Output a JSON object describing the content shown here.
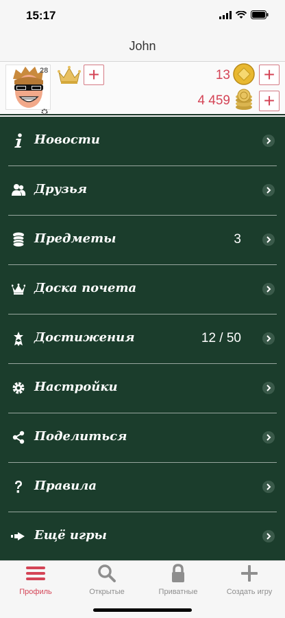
{
  "status_bar": {
    "time": "15:17"
  },
  "nav": {
    "title": "John"
  },
  "profile": {
    "level": "28",
    "coins_top": "13",
    "coins_bottom": "4 459"
  },
  "menu": {
    "items": [
      {
        "label": "Новости",
        "count": "",
        "icon": "info-icon"
      },
      {
        "label": "Друзья",
        "count": "",
        "icon": "friends-icon"
      },
      {
        "label": "Предметы",
        "count": "3",
        "icon": "coins-icon"
      },
      {
        "label": "Доска почета",
        "count": "",
        "icon": "crown-icon"
      },
      {
        "label": "Достижения",
        "count": "12 / 50",
        "icon": "medal-icon"
      },
      {
        "label": "Настройки",
        "count": "",
        "icon": "gear-icon"
      },
      {
        "label": "Поделиться",
        "count": "",
        "icon": "share-icon"
      },
      {
        "label": "Правила",
        "count": "",
        "icon": "question-icon"
      },
      {
        "label": "Ещё игры",
        "count": "",
        "icon": "more-games-icon"
      }
    ]
  },
  "tabs": [
    {
      "label": "Профиль",
      "icon": "menu-icon",
      "active": true
    },
    {
      "label": "Открытые",
      "icon": "search-icon",
      "active": false
    },
    {
      "label": "Приватные",
      "icon": "lock-icon",
      "active": false
    },
    {
      "label": "Создать игру",
      "icon": "plus-icon",
      "active": false
    }
  ],
  "colors": {
    "accent": "#d44456",
    "menu_bg": "#1b3d2c",
    "text_light": "#ffffff"
  }
}
